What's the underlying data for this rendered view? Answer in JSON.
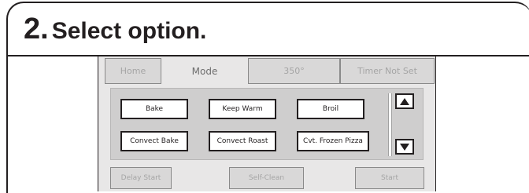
{
  "step": {
    "number": "2.",
    "title": "Select option."
  },
  "tabs": [
    {
      "label": "Home"
    },
    {
      "label": "Mode"
    },
    {
      "label": "350°"
    },
    {
      "label": "Timer Not Set"
    }
  ],
  "options": [
    {
      "label": "Bake"
    },
    {
      "label": "Keep Warm"
    },
    {
      "label": "Broil"
    },
    {
      "label": "Convect Bake"
    },
    {
      "label": "Convect Roast"
    },
    {
      "label": "Cvt. Frozen Pizza"
    }
  ],
  "scroll": {
    "up_icon": "arrow-up-icon",
    "down_icon": "arrow-down-icon"
  },
  "bottom_buttons": [
    {
      "label": "Delay Start"
    },
    {
      "label": "Self-Clean"
    },
    {
      "label": "Start"
    }
  ],
  "colors": {
    "screen_bg": "#e8e7e7",
    "panel_bg": "#cfcece",
    "ink": "#231f20",
    "disabled_text": "#a5a5a5"
  }
}
